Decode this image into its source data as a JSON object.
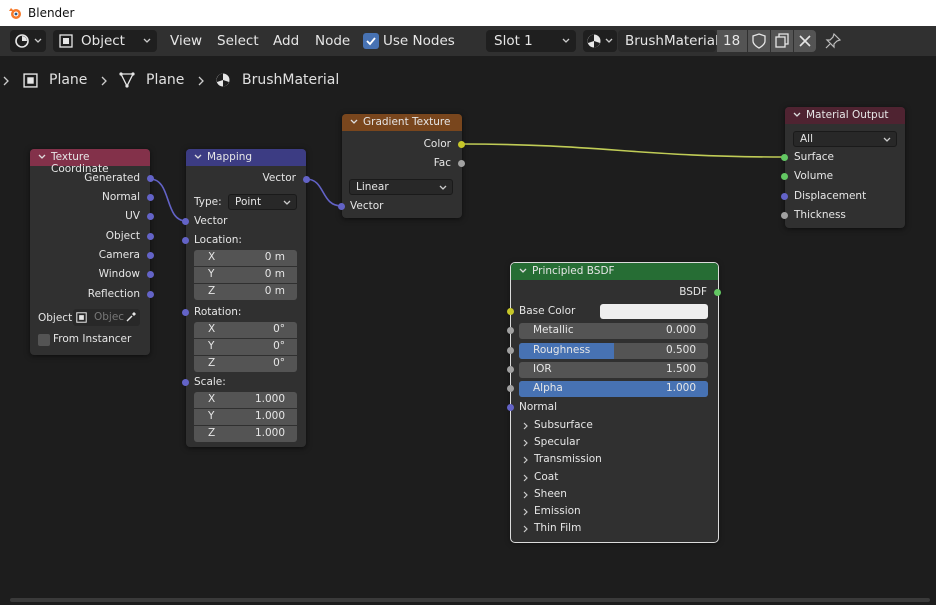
{
  "window": {
    "title": "Blender"
  },
  "header": {
    "editor_mode": "Object",
    "menus": [
      "View",
      "Select",
      "Add",
      "Node"
    ],
    "use_nodes_label": "Use Nodes",
    "use_nodes_checked": true,
    "slot": "Slot 1",
    "material_name": "BrushMaterial",
    "user_count": "18"
  },
  "breadcrumb": {
    "object": "Plane",
    "mesh": "Plane",
    "material": "BrushMaterial"
  },
  "colors": {
    "texture_coordinate_header": "#83314a",
    "mapping_header": "#3c3c83",
    "gradient_header": "#79461d",
    "output_header": "#4f2331",
    "bsdf_header": "#266d34",
    "vector_socket": "#6363c7",
    "color_socket": "#c7c729",
    "shader_socket": "#63c763",
    "float_socket": "#a1a1a1",
    "link_color_to_surface": "#c0cc56",
    "field_highlight": "#4772b3"
  },
  "nodes": {
    "texture_coordinate": {
      "title": "Texture Coordinate",
      "outputs": [
        "Generated",
        "Normal",
        "UV",
        "Object",
        "Camera",
        "Window",
        "Reflection"
      ],
      "object_label": "Object:",
      "object_placeholder": "Objec",
      "from_instancer": "From Instancer"
    },
    "mapping": {
      "title": "Mapping",
      "output": "Vector",
      "type_label": "Type:",
      "type_value": "Point",
      "vector_input": "Vector",
      "location_label": "Location:",
      "location": [
        {
          "axis": "X",
          "value": "0 m"
        },
        {
          "axis": "Y",
          "value": "0 m"
        },
        {
          "axis": "Z",
          "value": "0 m"
        }
      ],
      "rotation_label": "Rotation:",
      "rotation": [
        {
          "axis": "X",
          "value": "0°"
        },
        {
          "axis": "Y",
          "value": "0°"
        },
        {
          "axis": "Z",
          "value": "0°"
        }
      ],
      "scale_label": "Scale:",
      "scale": [
        {
          "axis": "X",
          "value": "1.000"
        },
        {
          "axis": "Y",
          "value": "1.000"
        },
        {
          "axis": "Z",
          "value": "1.000"
        }
      ]
    },
    "gradient_texture": {
      "title": "Gradient Texture",
      "outputs": [
        "Color",
        "Fac"
      ],
      "type_value": "Linear",
      "vector_input": "Vector"
    },
    "material_output": {
      "title": "Material Output",
      "target": "All",
      "inputs": [
        "Surface",
        "Volume",
        "Displacement",
        "Thickness"
      ]
    },
    "principled_bsdf": {
      "title": "Principled BSDF",
      "output": "BSDF",
      "base_color_label": "Base Color",
      "base_color_value": "#eeeeee",
      "fields": [
        {
          "label": "Metallic",
          "value": "0.000",
          "fill": 0.0
        },
        {
          "label": "Roughness",
          "value": "0.500",
          "fill": 0.5
        },
        {
          "label": "IOR",
          "value": "1.500",
          "fill": 0.0
        },
        {
          "label": "Alpha",
          "value": "1.000",
          "fill": 1.0
        }
      ],
      "normal_label": "Normal",
      "panels": [
        "Subsurface",
        "Specular",
        "Transmission",
        "Coat",
        "Sheen",
        "Emission",
        "Thin Film"
      ]
    }
  }
}
